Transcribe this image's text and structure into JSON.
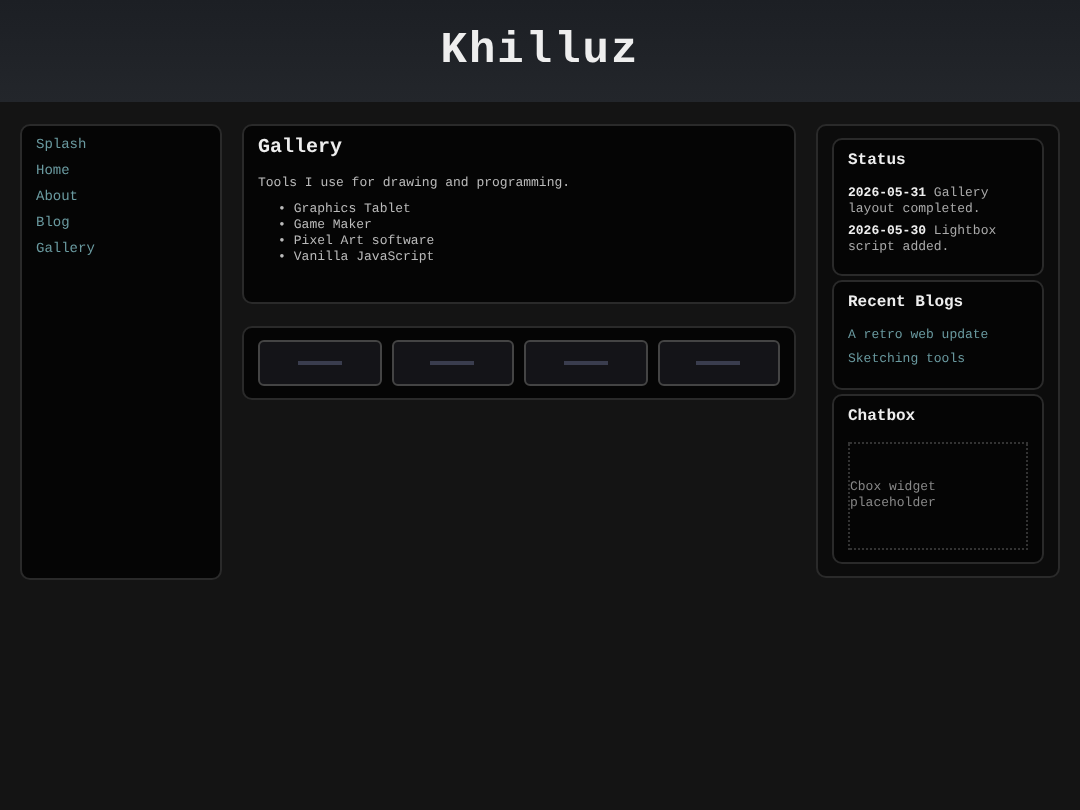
{
  "header": {
    "title": "Khilluz"
  },
  "nav": [
    {
      "label": "Splash"
    },
    {
      "label": "Home"
    },
    {
      "label": "About"
    },
    {
      "label": "Blog"
    },
    {
      "label": "Gallery"
    }
  ],
  "main": {
    "title": "Gallery",
    "intro": "Tools I use for drawing and programming.",
    "bullet": "•",
    "tools": [
      "Graphics Tablet",
      "Game Maker",
      "Pixel Art software",
      "Vanilla JavaScript"
    ],
    "thumbnails": [
      {
        "kind": "thumbnail"
      },
      {
        "kind": "thumbnail"
      },
      {
        "kind": "thumbnail"
      },
      {
        "kind": "thumbnail"
      }
    ]
  },
  "status": {
    "title": "Status",
    "entries": [
      {
        "date": "2026-05-31",
        "text": "Gallery layout completed."
      },
      {
        "date": "2026-05-30",
        "text": "Lightbox script added."
      }
    ]
  },
  "recent_blogs": {
    "title": "Recent Blogs",
    "links": [
      "A retro web update",
      "Sketching tools"
    ]
  },
  "chatbox": {
    "title": "Chatbox",
    "placeholder": "Cbox widget placeholder"
  }
}
